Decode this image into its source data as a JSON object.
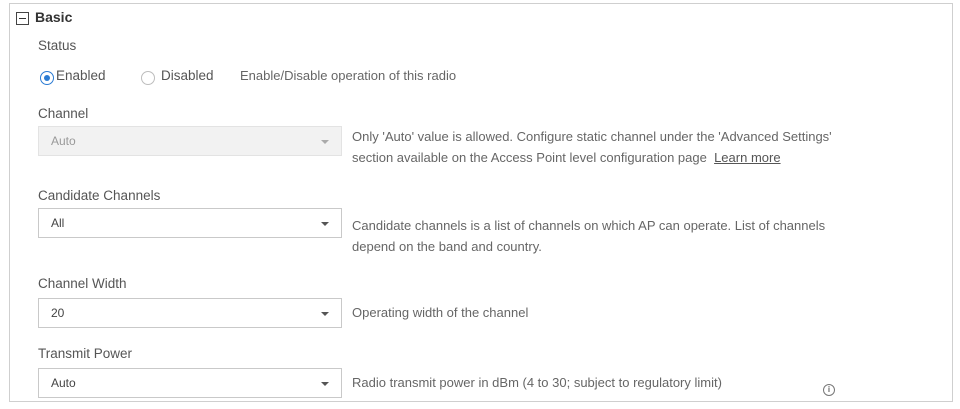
{
  "section": {
    "title": "Basic"
  },
  "status": {
    "label": "Status",
    "options": [
      "Enabled",
      "Disabled"
    ],
    "selected": "Enabled",
    "hint": "Enable/Disable operation of this radio"
  },
  "channel": {
    "label": "Channel",
    "value": "Auto",
    "hint_line1": "Only 'Auto' value is allowed. Configure static channel under the 'Advanced Settings'",
    "hint_line2": "section available on the Access Point level configuration page",
    "learn_more": "Learn more"
  },
  "candidate_channels": {
    "label": "Candidate Channels",
    "value": "All",
    "hint_line1": "Candidate channels is a list of channels on which AP can operate. List of channels",
    "hint_line2": "depend on the band and country."
  },
  "channel_width": {
    "label": "Channel Width",
    "value": "20",
    "hint": "Operating width of the channel"
  },
  "transmit_power": {
    "label": "Transmit Power",
    "value": "Auto",
    "hint": "Radio transmit power in dBm (4 to 30; subject to regulatory limit)"
  },
  "colors": {
    "accent": "#2b7bd3",
    "border": "#c9c9c9"
  }
}
